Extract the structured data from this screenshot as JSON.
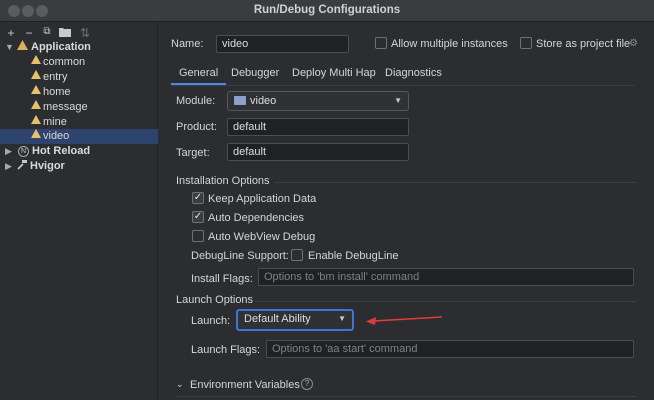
{
  "window": {
    "title": "Run/Debug Configurations"
  },
  "toolbar": {
    "add": "+",
    "remove": "−",
    "copy": "⧉",
    "folder": "▸",
    "sort": "⇅"
  },
  "tree": {
    "application": {
      "label": "Application",
      "expanded": true
    },
    "children": [
      {
        "label": "common"
      },
      {
        "label": "entry"
      },
      {
        "label": "home"
      },
      {
        "label": "message"
      },
      {
        "label": "mine"
      },
      {
        "label": "video",
        "selected": true
      }
    ],
    "hot_reload": {
      "label": "Hot Reload",
      "icon_letter": "N"
    },
    "hvigor": {
      "label": "Hvigor"
    }
  },
  "config": {
    "name_label": "Name:",
    "name_value": "video",
    "allow_multiple_label": "Allow multiple instances",
    "allow_multiple_checked": false,
    "store_label": "Store as project file",
    "store_checked": false
  },
  "tabs": [
    "General",
    "Debugger",
    "Deploy Multi Hap",
    "Diagnostics"
  ],
  "active_tab": "General",
  "general": {
    "module_label": "Module:",
    "module_value": "video",
    "product_label": "Product:",
    "product_value": "default",
    "target_label": "Target:",
    "target_value": "default",
    "install_section": "Installation Options",
    "keep_data_label": "Keep Application Data",
    "keep_data_checked": true,
    "auto_deps_label": "Auto Dependencies",
    "auto_deps_checked": true,
    "auto_webview_label": "Auto WebView Debug",
    "auto_webview_checked": false,
    "debugline_label": "DebugLine Support:",
    "enable_debugline_label": "Enable DebugLine",
    "enable_debugline_checked": false,
    "install_flags_label": "Install Flags:",
    "install_flags_placeholder": "Options to 'bm install' command",
    "launch_section": "Launch Options",
    "launch_label": "Launch:",
    "launch_value": "Default Ability",
    "launch_flags_label": "Launch Flags:",
    "launch_flags_placeholder": "Options to 'aa start' command",
    "env_section": "Environment Variables",
    "help": "?"
  },
  "colors": {
    "accent": "#4a86e8",
    "selection": "#2e436e",
    "annotation_arrow": "#e03a3a",
    "app_icon": "#d8b25a"
  }
}
